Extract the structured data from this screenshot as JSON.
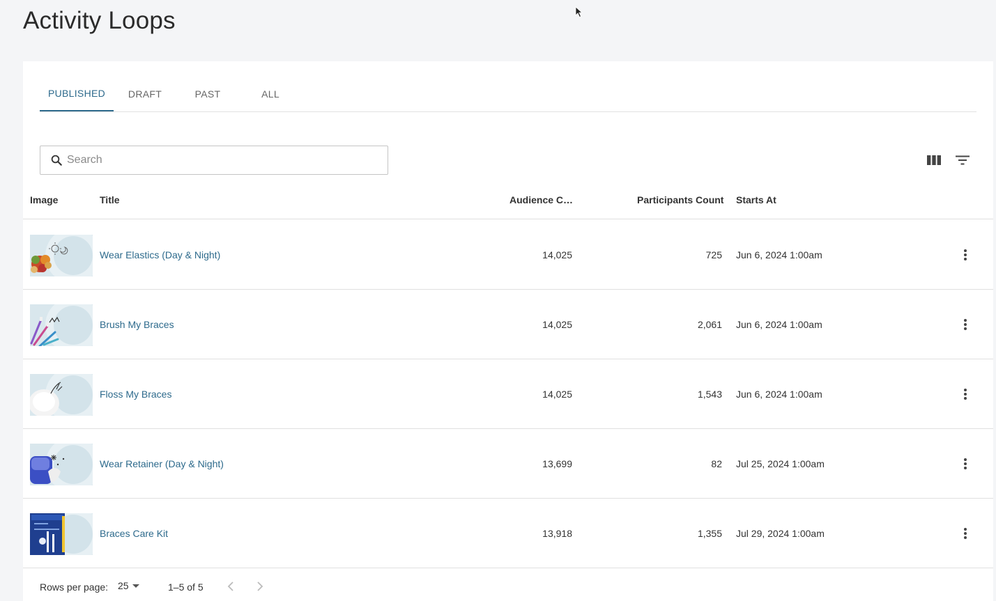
{
  "page": {
    "title": "Activity Loops"
  },
  "tabs": [
    {
      "label": "PUBLISHED",
      "active": true
    },
    {
      "label": "DRAFT",
      "active": false
    },
    {
      "label": "PAST",
      "active": false
    },
    {
      "label": "ALL",
      "active": false
    }
  ],
  "search": {
    "placeholder": "Search",
    "value": ""
  },
  "toolbar": {
    "columns_icon": "view-column-icon",
    "filter_icon": "filter-list-icon"
  },
  "table": {
    "headers": {
      "image": "Image",
      "title": "Title",
      "audience": "Audience C…",
      "participants": "Participants Count",
      "starts_at": "Starts At"
    },
    "rows": [
      {
        "title": "Wear Elastics (Day & Night)",
        "audience": "14,025",
        "participants": "725",
        "starts_at": "Jun 6, 2024 1:00am",
        "image": "elastics-thumbnail"
      },
      {
        "title": "Brush My Braces",
        "audience": "14,025",
        "participants": "2,061",
        "starts_at": "Jun 6, 2024 1:00am",
        "image": "toothbrush-thumbnail"
      },
      {
        "title": "Floss My Braces",
        "audience": "14,025",
        "participants": "1,543",
        "starts_at": "Jun 6, 2024 1:00am",
        "image": "floss-thumbnail"
      },
      {
        "title": "Wear Retainer (Day & Night)",
        "audience": "13,699",
        "participants": "82",
        "starts_at": "Jul 25, 2024 1:00am",
        "image": "retainer-thumbnail"
      },
      {
        "title": "Braces Care Kit",
        "audience": "13,918",
        "participants": "1,355",
        "starts_at": "Jul 29, 2024 1:00am",
        "image": "care-kit-thumbnail"
      }
    ]
  },
  "pagination": {
    "rows_per_page_label": "Rows per page:",
    "rows_per_page_value": "25",
    "range": "1–5 of 5"
  },
  "colors": {
    "accent": "#2d6a8c",
    "background": "#f4f5f7"
  }
}
